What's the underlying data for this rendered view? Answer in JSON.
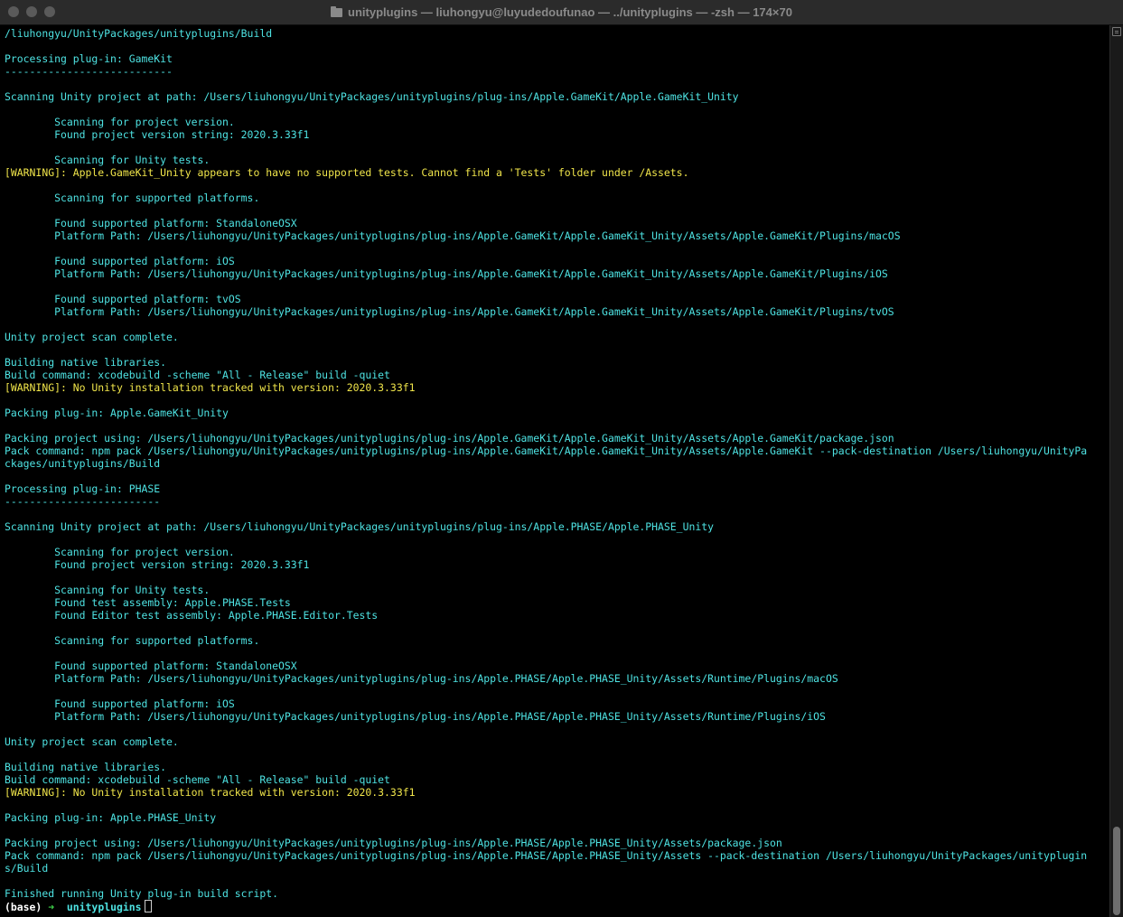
{
  "window": {
    "title": "unityplugins — liuhongyu@luyudedoufunao — ../unityplugins — -zsh — 174×70",
    "folder_icon": "folder-icon"
  },
  "terminal": {
    "lines": [
      {
        "text": "/liuhongyu/UnityPackages/unityplugins/Build",
        "kind": "normal"
      },
      {
        "text": "",
        "kind": "normal"
      },
      {
        "text": "Processing plug-in: GameKit",
        "kind": "normal"
      },
      {
        "text": "---------------------------",
        "kind": "normal"
      },
      {
        "text": "",
        "kind": "normal"
      },
      {
        "text": "Scanning Unity project at path: /Users/liuhongyu/UnityPackages/unityplugins/plug-ins/Apple.GameKit/Apple.GameKit_Unity",
        "kind": "normal"
      },
      {
        "text": "",
        "kind": "normal"
      },
      {
        "text": "        Scanning for project version.",
        "kind": "normal"
      },
      {
        "text": "        Found project version string: 2020.3.33f1",
        "kind": "normal"
      },
      {
        "text": "",
        "kind": "normal"
      },
      {
        "text": "        Scanning for Unity tests.",
        "kind": "normal"
      },
      {
        "text": "[WARNING]: Apple.GameKit_Unity appears to have no supported tests. Cannot find a 'Tests' folder under /Assets.",
        "kind": "warn"
      },
      {
        "text": "",
        "kind": "normal"
      },
      {
        "text": "        Scanning for supported platforms.",
        "kind": "normal"
      },
      {
        "text": "",
        "kind": "normal"
      },
      {
        "text": "        Found supported platform: StandaloneOSX",
        "kind": "normal"
      },
      {
        "text": "        Platform Path: /Users/liuhongyu/UnityPackages/unityplugins/plug-ins/Apple.GameKit/Apple.GameKit_Unity/Assets/Apple.GameKit/Plugins/macOS",
        "kind": "normal"
      },
      {
        "text": "",
        "kind": "normal"
      },
      {
        "text": "        Found supported platform: iOS",
        "kind": "normal"
      },
      {
        "text": "        Platform Path: /Users/liuhongyu/UnityPackages/unityplugins/plug-ins/Apple.GameKit/Apple.GameKit_Unity/Assets/Apple.GameKit/Plugins/iOS",
        "kind": "normal"
      },
      {
        "text": "",
        "kind": "normal"
      },
      {
        "text": "        Found supported platform: tvOS",
        "kind": "normal"
      },
      {
        "text": "        Platform Path: /Users/liuhongyu/UnityPackages/unityplugins/plug-ins/Apple.GameKit/Apple.GameKit_Unity/Assets/Apple.GameKit/Plugins/tvOS",
        "kind": "normal"
      },
      {
        "text": "",
        "kind": "normal"
      },
      {
        "text": "Unity project scan complete.",
        "kind": "normal"
      },
      {
        "text": "",
        "kind": "normal"
      },
      {
        "text": "Building native libraries.",
        "kind": "normal"
      },
      {
        "text": "Build command: xcodebuild -scheme \"All - Release\" build -quiet",
        "kind": "normal"
      },
      {
        "text": "[WARNING]: No Unity installation tracked with version: 2020.3.33f1",
        "kind": "warn"
      },
      {
        "text": "",
        "kind": "normal"
      },
      {
        "text": "Packing plug-in: Apple.GameKit_Unity",
        "kind": "normal"
      },
      {
        "text": "",
        "kind": "normal"
      },
      {
        "text": "Packing project using: /Users/liuhongyu/UnityPackages/unityplugins/plug-ins/Apple.GameKit/Apple.GameKit_Unity/Assets/Apple.GameKit/package.json",
        "kind": "normal"
      },
      {
        "text": "Pack command: npm pack /Users/liuhongyu/UnityPackages/unityplugins/plug-ins/Apple.GameKit/Apple.GameKit_Unity/Assets/Apple.GameKit --pack-destination /Users/liuhongyu/UnityPa",
        "kind": "normal"
      },
      {
        "text": "ckages/unityplugins/Build",
        "kind": "normal"
      },
      {
        "text": "",
        "kind": "normal"
      },
      {
        "text": "Processing plug-in: PHASE",
        "kind": "normal"
      },
      {
        "text": "-------------------------",
        "kind": "normal"
      },
      {
        "text": "",
        "kind": "normal"
      },
      {
        "text": "Scanning Unity project at path: /Users/liuhongyu/UnityPackages/unityplugins/plug-ins/Apple.PHASE/Apple.PHASE_Unity",
        "kind": "normal"
      },
      {
        "text": "",
        "kind": "normal"
      },
      {
        "text": "        Scanning for project version.",
        "kind": "normal"
      },
      {
        "text": "        Found project version string: 2020.3.33f1",
        "kind": "normal"
      },
      {
        "text": "",
        "kind": "normal"
      },
      {
        "text": "        Scanning for Unity tests.",
        "kind": "normal"
      },
      {
        "text": "        Found test assembly: Apple.PHASE.Tests",
        "kind": "normal"
      },
      {
        "text": "        Found Editor test assembly: Apple.PHASE.Editor.Tests",
        "kind": "normal"
      },
      {
        "text": "",
        "kind": "normal"
      },
      {
        "text": "        Scanning for supported platforms.",
        "kind": "normal"
      },
      {
        "text": "",
        "kind": "normal"
      },
      {
        "text": "        Found supported platform: StandaloneOSX",
        "kind": "normal"
      },
      {
        "text": "        Platform Path: /Users/liuhongyu/UnityPackages/unityplugins/plug-ins/Apple.PHASE/Apple.PHASE_Unity/Assets/Runtime/Plugins/macOS",
        "kind": "normal"
      },
      {
        "text": "",
        "kind": "normal"
      },
      {
        "text": "        Found supported platform: iOS",
        "kind": "normal"
      },
      {
        "text": "        Platform Path: /Users/liuhongyu/UnityPackages/unityplugins/plug-ins/Apple.PHASE/Apple.PHASE_Unity/Assets/Runtime/Plugins/iOS",
        "kind": "normal"
      },
      {
        "text": "",
        "kind": "normal"
      },
      {
        "text": "Unity project scan complete.",
        "kind": "normal"
      },
      {
        "text": "",
        "kind": "normal"
      },
      {
        "text": "Building native libraries.",
        "kind": "normal"
      },
      {
        "text": "Build command: xcodebuild -scheme \"All - Release\" build -quiet",
        "kind": "normal"
      },
      {
        "text": "[WARNING]: No Unity installation tracked with version: 2020.3.33f1",
        "kind": "warn"
      },
      {
        "text": "",
        "kind": "normal"
      },
      {
        "text": "Packing plug-in: Apple.PHASE_Unity",
        "kind": "normal"
      },
      {
        "text": "",
        "kind": "normal"
      },
      {
        "text": "Packing project using: /Users/liuhongyu/UnityPackages/unityplugins/plug-ins/Apple.PHASE/Apple.PHASE_Unity/Assets/package.json",
        "kind": "normal"
      },
      {
        "text": "Pack command: npm pack /Users/liuhongyu/UnityPackages/unityplugins/plug-ins/Apple.PHASE/Apple.PHASE_Unity/Assets --pack-destination /Users/liuhongyu/UnityPackages/unityplugin",
        "kind": "normal"
      },
      {
        "text": "s/Build",
        "kind": "normal"
      },
      {
        "text": "",
        "kind": "normal"
      },
      {
        "text": "Finished running Unity plug-in build script.",
        "kind": "normal"
      }
    ],
    "prompt": {
      "env": "(base)",
      "arrow": "➜",
      "dir": "unityplugins"
    }
  },
  "colors": {
    "output": "#4ee3e3",
    "warning": "#f0e54a",
    "prompt_arrow": "#3fd24b",
    "background": "#000000"
  }
}
